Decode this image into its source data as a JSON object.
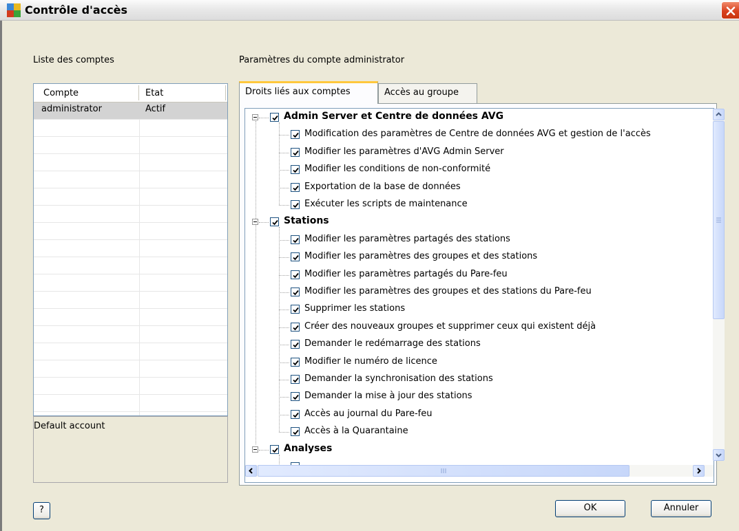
{
  "window": {
    "title": "Contrôle d'accès"
  },
  "accounts": {
    "section_label": "Liste des comptes",
    "columns": [
      "Compte",
      "Etat"
    ],
    "rows": [
      {
        "name": "administrator",
        "state": "Actif",
        "selected": true
      }
    ],
    "description": "Default account"
  },
  "settings": {
    "section_label": "Paramètres du compte administrator",
    "tabs": [
      {
        "label": "Droits liés aux comptes",
        "active": true
      },
      {
        "label": "Accès au groupe",
        "active": false
      }
    ],
    "tree": [
      {
        "label": "Admin Server et Centre de données AVG",
        "checked": true,
        "children": [
          {
            "label": "Modification des paramètres de Centre de données AVG et gestion de l'accès",
            "checked": true
          },
          {
            "label": "Modifier les paramètres d'AVG Admin Server",
            "checked": true
          },
          {
            "label": "Modifier les conditions de non-conformité",
            "checked": true
          },
          {
            "label": "Exportation de la base de données",
            "checked": true
          },
          {
            "label": "Exécuter les scripts de maintenance",
            "checked": true
          }
        ]
      },
      {
        "label": "Stations",
        "checked": true,
        "children": [
          {
            "label": "Modifier les paramètres partagés des stations",
            "checked": true
          },
          {
            "label": "Modifier les paramètres des groupes et des stations",
            "checked": true
          },
          {
            "label": "Modifier les paramètres partagés du Pare-feu",
            "checked": true
          },
          {
            "label": "Modifier les paramètres des groupes et des stations du Pare-feu",
            "checked": true
          },
          {
            "label": "Supprimer les stations",
            "checked": true
          },
          {
            "label": "Créer des nouveaux groupes et supprimer ceux qui existent déjà",
            "checked": true
          },
          {
            "label": "Demander le redémarrage des stations",
            "checked": true
          },
          {
            "label": "Modifier le numéro de licence",
            "checked": true
          },
          {
            "label": "Demander la synchronisation des stations",
            "checked": true
          },
          {
            "label": "Demander la mise à jour des stations",
            "checked": true
          },
          {
            "label": "Accès au journal du Pare-feu",
            "checked": true
          },
          {
            "label": "Accès à la Quarantaine",
            "checked": true
          }
        ]
      },
      {
        "label": "Analyses",
        "checked": true,
        "children": []
      }
    ]
  },
  "buttons": {
    "help": "?",
    "ok": "OK",
    "cancel": "Annuler"
  },
  "icons": {
    "app": "avg-app-icon",
    "close": "close-icon"
  }
}
